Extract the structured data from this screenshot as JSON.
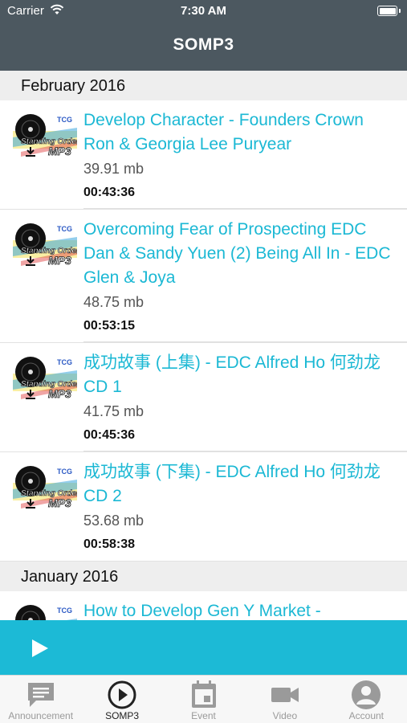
{
  "status_bar": {
    "carrier": "Carrier",
    "time": "7:30 AM"
  },
  "nav": {
    "title": "SOMP3"
  },
  "sections": [
    {
      "header": "February 2016",
      "tracks": [
        {
          "title": "Develop Character - Founders Crown Ron & Georgia Lee Puryear",
          "size": "39.91 mb",
          "duration": "00:43:36"
        },
        {
          "title": "Overcoming Fear of Prospecting EDC Dan & Sandy Yuen (2) Being All In - EDC Glen & Joya",
          "size": "48.75 mb",
          "duration": "00:53:15"
        },
        {
          "title": "成功故事 (上集) - EDC Alfred Ho 何劲龙 CD 1",
          "size": "41.75 mb",
          "duration": "00:45:36"
        },
        {
          "title": "成功故事 (下集) - EDC Alfred Ho 何劲龙 CD 2",
          "size": "53.68 mb",
          "duration": "00:58:38"
        }
      ]
    },
    {
      "header": "January 2016",
      "tracks": [
        {
          "title": "How to Develop Gen Y Market -",
          "size": "",
          "duration": ""
        }
      ]
    }
  ],
  "thumbnail": {
    "brand": "TCG",
    "line1": "Standing Order",
    "line2": "MP3"
  },
  "tabs": [
    {
      "label": "Announcement",
      "icon": "chat-bubble-icon",
      "active": false
    },
    {
      "label": "SOMP3",
      "icon": "play-circle-icon",
      "active": true
    },
    {
      "label": "Event",
      "icon": "calendar-icon",
      "active": false
    },
    {
      "label": "Video",
      "icon": "video-camera-icon",
      "active": false
    },
    {
      "label": "Account",
      "icon": "person-icon",
      "active": false
    }
  ],
  "colors": {
    "nav": "#4c5860",
    "accent": "#1cbad6",
    "title": "#1bb8d4"
  }
}
